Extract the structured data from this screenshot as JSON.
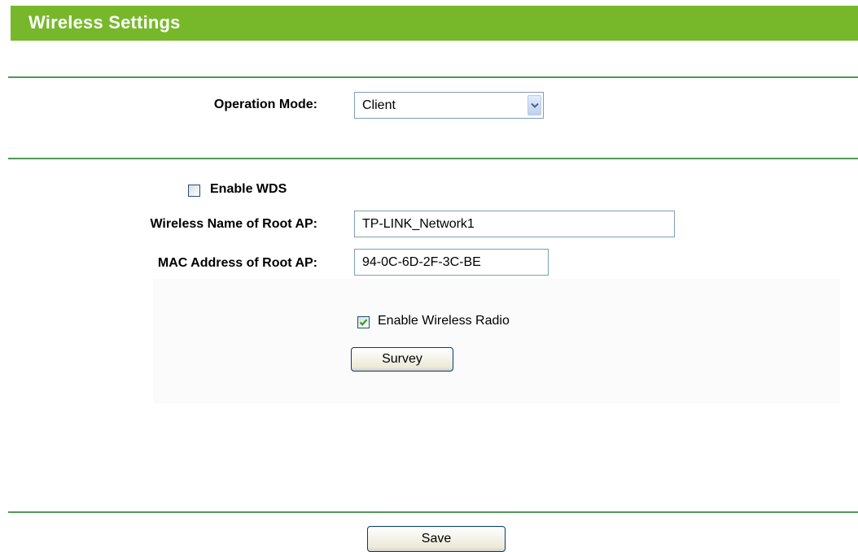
{
  "header": {
    "title": "Wireless Settings"
  },
  "operation_mode": {
    "label": "Operation Mode:",
    "value": "Client"
  },
  "wds": {
    "label": "Enable WDS",
    "checked": false
  },
  "root_ap_name": {
    "label": "Wireless Name of Root AP:",
    "value": "TP-LINK_Network1"
  },
  "root_ap_mac": {
    "label": "MAC Address of Root AP:",
    "value": "94-0C-6D-2F-3C-BE"
  },
  "wireless_radio": {
    "label": "Enable Wireless Radio",
    "checked": true
  },
  "buttons": {
    "survey": "Survey",
    "save": "Save"
  },
  "colors": {
    "header_bg": "#76b82a",
    "divider": "#4f9a55",
    "checkmark": "#21a121"
  },
  "icons": {
    "dropdown": "chevron-down-icon",
    "check": "checkmark-icon"
  }
}
